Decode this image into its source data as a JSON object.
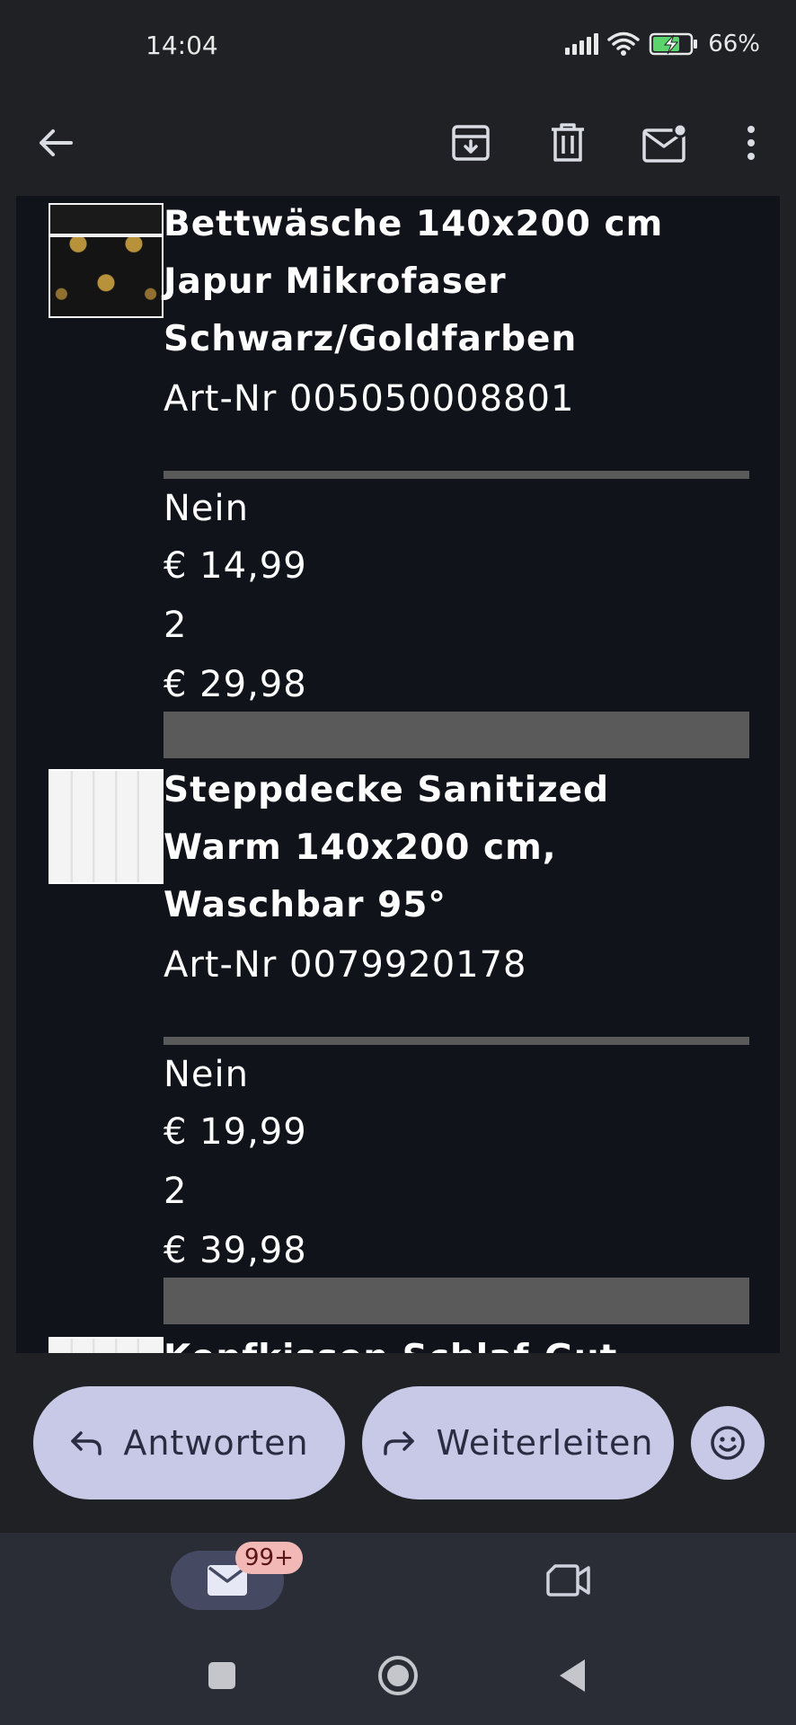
{
  "status_bar": {
    "time": "14:04",
    "battery": "66%",
    "icons": [
      "signal-icon",
      "wifi-icon",
      "battery-charging-icon"
    ]
  },
  "app_bar": {
    "icons": [
      "back-arrow-icon",
      "archive-icon",
      "delete-icon",
      "mark-unread-icon",
      "more-vert-icon"
    ]
  },
  "products": [
    {
      "title": "Bettwäsche 140x200 cm Japur Mikrofaser Schwarz/Goldfarben",
      "title_lines": [
        "Bettwäsche 140x200 cm",
        "Japur Mikrofaser",
        "Schwarz/Goldfarben"
      ],
      "art_nr": "Art-Nr 005050008801",
      "option": "Nein",
      "unit_price": "€ 14,99",
      "quantity": "2",
      "total": "€ 29,98"
    },
    {
      "title": "Steppdecke Sanitized Warm 140x200 cm, Waschbar 95°",
      "title_lines": [
        "Steppdecke Sanitized",
        "Warm 140x200 cm,",
        "Waschbar 95°"
      ],
      "art_nr": "Art-Nr 0079920178",
      "option": "Nein",
      "unit_price": "€ 19,99",
      "quantity": "2",
      "total": "€ 39,98"
    },
    {
      "title_lines": [
        "Kopfkissen Schlaf-Gut"
      ]
    }
  ],
  "actions": {
    "reply_label": "Antworten",
    "forward_label": "Weiterleiten"
  },
  "bottom_nav": {
    "mail_badge": "99+"
  },
  "colors": {
    "background": "#1f2125",
    "content_bg": "#11131a",
    "pill": "#c8c9e6",
    "pill_text": "#2a2c42",
    "rule": "#5a5a5a",
    "badge": "#f2b8b5"
  }
}
